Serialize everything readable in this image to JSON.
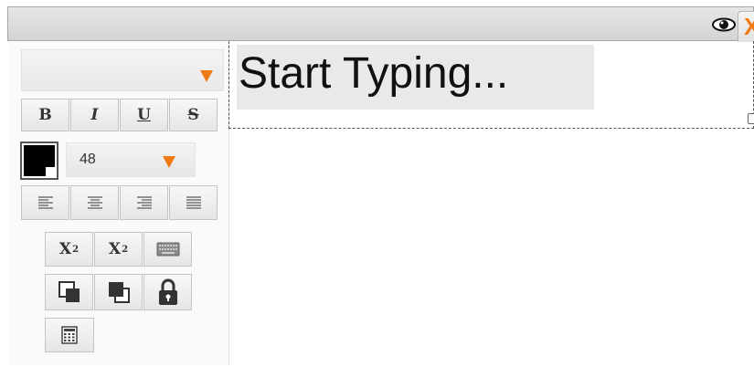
{
  "toolbar": {
    "font_family_value": "",
    "format_buttons": {
      "bold": "B",
      "italic": "I",
      "underline": "U",
      "strike": "S"
    },
    "font_size_value": "48",
    "text_color": "#000000",
    "script_buttons": {
      "subscript": "X",
      "subscript_mark": "2",
      "superscript": "X",
      "superscript_mark": "2"
    }
  },
  "topbar": {
    "close_label": "X"
  },
  "canvas": {
    "placeholder": "Start Typing..."
  },
  "icons": {
    "visibility": "eye-icon",
    "align": [
      "align-left-icon",
      "align-center-icon",
      "align-right-icon",
      "align-justify-icon"
    ],
    "keyboard": "keyboard-icon",
    "layer": [
      "bring-forward-icon",
      "send-backward-icon",
      "lock-icon"
    ],
    "calculator": "calculator-icon"
  },
  "colors": {
    "accent": "#f07a14"
  }
}
